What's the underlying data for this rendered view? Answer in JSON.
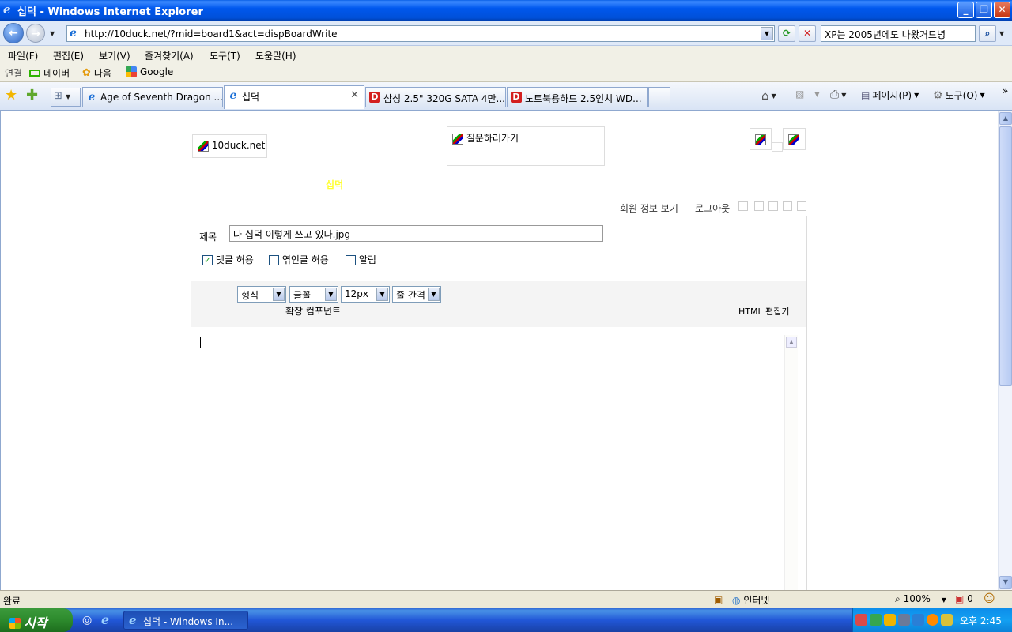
{
  "window": {
    "title": "십덕 - Windows Internet Explorer"
  },
  "address": {
    "url": "http://10duck.net/?mid=board1&act=dispBoardWrite"
  },
  "search": {
    "value": "XP는 2005년에도 나왔거드녕"
  },
  "menu": [
    "파일(F)",
    "편집(E)",
    "보기(V)",
    "즐겨찾기(A)",
    "도구(T)",
    "도움말(H)"
  ],
  "links": {
    "label": "연결",
    "items": [
      "네이버",
      "다음",
      "Google"
    ]
  },
  "tabs": [
    {
      "label": "Age of Seventh Dragon ..."
    },
    {
      "label": "십덕"
    },
    {
      "label": "삼성 2.5\" 320G SATA 4만..."
    },
    {
      "label": "노트북용하드 2.5인치 WD..."
    }
  ],
  "commands": {
    "page": "페이지(P)",
    "tools": "도구(O)"
  },
  "page": {
    "logo_text": "10duck.net",
    "question_link": "질문하러가기",
    "site_name": "십덕",
    "member_info": "회원 정보 보기",
    "logout": "로그아웃",
    "title_label": "제목",
    "title_value": "나 십덕 이렇게 쓰고 있다.jpg",
    "options": [
      {
        "label": "댓글 허용",
        "checked": true
      },
      {
        "label": "엮인글 허용",
        "checked": false
      },
      {
        "label": "알림",
        "checked": false
      }
    ],
    "editor": {
      "format": "형식",
      "font": "글꼴",
      "size": "12px",
      "line_spacing": "줄 간격",
      "ext_component": "확장 컴포넌트",
      "html_editor": "HTML 편집기"
    }
  },
  "status": {
    "text": "완료",
    "zone": "인터넷",
    "zoom": "100%",
    "popups": "0"
  },
  "taskbar": {
    "start": "시작",
    "item": "십덕 - Windows In...",
    "clock": "오후 2:45"
  },
  "colors": {
    "site_name": "#ffff33",
    "accent": "#0058ee"
  }
}
